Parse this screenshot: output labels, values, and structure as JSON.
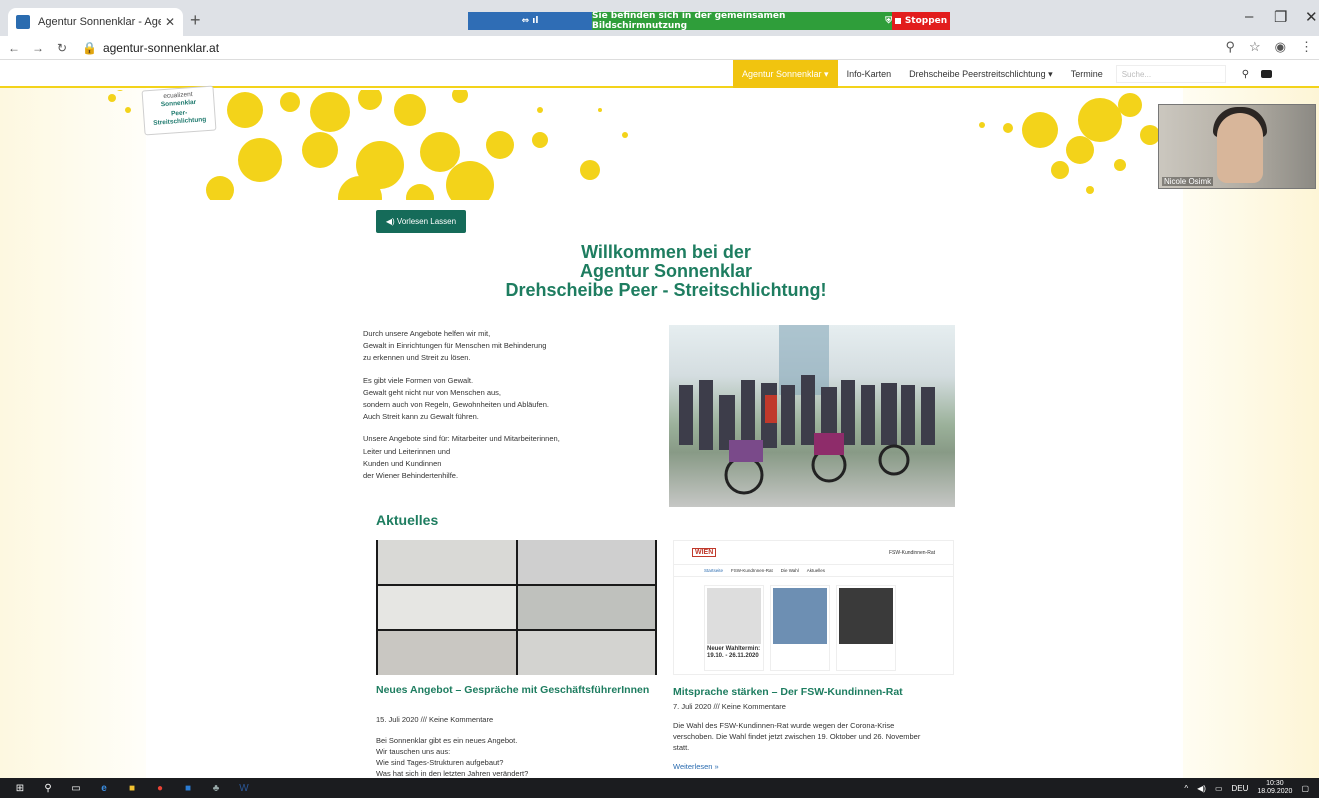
{
  "browser": {
    "tab_title": "Agentur Sonnenklar - Agentur So",
    "tab_close": "✕",
    "new_tab": "+",
    "url": "agentur-sonnenklar.at"
  },
  "screenshare": {
    "status": "Sie befinden sich in der gemeinsamen Bildschirmnutzung",
    "stop_label": "Stoppen"
  },
  "site": {
    "logo": {
      "line1": "ecualizent",
      "line2": "Sonnenklar",
      "line3": "Peer-",
      "line4": "Streitschlichtung"
    },
    "menu": [
      {
        "label": "Agentur Sonnenklar ▾"
      },
      {
        "label": "Info-Karten"
      },
      {
        "label": "Drehscheibe Peerstreitschlichtung ▾"
      },
      {
        "label": "Termine"
      }
    ],
    "search_placeholder": "Suche...",
    "vorlesen_label": "◀) Vorlesen Lassen",
    "welcome": [
      "Willkommen bei der",
      "Agentur Sonnenklar",
      "Drehscheibe Peer - Streitschlichtung!"
    ],
    "intro": [
      [
        "Durch unsere Angebote helfen wir mit,",
        "Gewalt in Einrichtungen für Menschen mit Behinderung",
        "zu erkennen und Streit zu lösen."
      ],
      [
        "Es gibt viele Formen von Gewalt.",
        "Gewalt geht nicht nur von Menschen aus,",
        "sondern auch von Regeln, Gewohnheiten und Abläufen.",
        "Auch Streit kann zu Gewalt führen."
      ],
      [
        "Unsere Angebote sind für: Mitarbeiter und Mitarbeiterinnen,",
        "Leiter und Leiterinnen und",
        "Kunden und Kundinnen",
        "der Wiener Behindertenhilfe."
      ]
    ],
    "aktuelles_heading": "Aktuelles",
    "fsw_mock": {
      "logo_left": "WIEN",
      "logo_right": "FSW-Kundinnen-Rat",
      "nav": [
        "Startseite",
        "FSW-KundInnen-Rat",
        "Die Wahl",
        "Aktuelles"
      ],
      "card1": "Neuer Wahltermin: 19.10. - 26.11.2020"
    },
    "posts": [
      {
        "title": "Neues Angebot – Gespräche mit GeschäftsführerInnen",
        "meta": "15. Juli 2020 /// Keine Kommentare",
        "text": [
          "Bei Sonnenklar gibt es ein neues Angebot.",
          "Wir tauschen uns aus:",
          "Wie sind Tages-Strukturen aufgebaut?",
          "Was hat sich in den letzten Jahren verändert?"
        ]
      },
      {
        "title": "Mitsprache stärken – Der FSW-Kundinnen-Rat",
        "meta": "7. Juli 2020 /// Keine Kommentare",
        "text": [
          "Die Wahl des FSW-Kundinnen-Rat wurde wegen der Corona-Krise",
          "verschoben. Die Wahl findet jetzt zwischen 19. Oktober und 26. November",
          "statt."
        ],
        "more": "Weiterlesen »"
      }
    ]
  },
  "video": {
    "name": "Nicole Osimk"
  },
  "taskbar": {
    "lang": "DEU",
    "time": "10:30",
    "date": "18.09.2020"
  },
  "colors": {
    "accent_green": "#1e7d60",
    "brand_yellow": "#f1c40f",
    "button_green": "#156b59"
  }
}
